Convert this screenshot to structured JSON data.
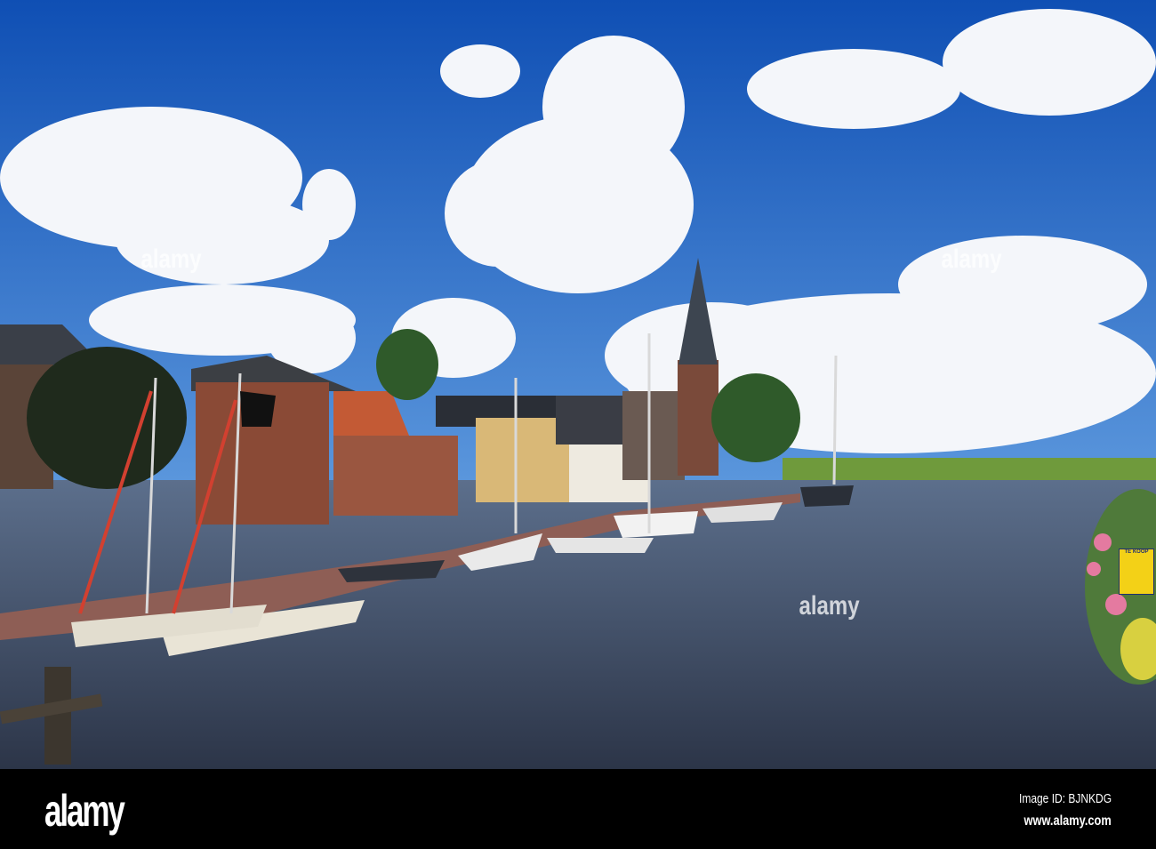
{
  "scene": {
    "description_tags": [
      "river",
      "village",
      "church-tower",
      "sailboats",
      "clouds"
    ],
    "colors": {
      "sky_top": "#0f4fb4",
      "sky_bottom": "#5a96dc",
      "water": "#3b4a62",
      "field": "#6f9a3c",
      "brick": "#8a4a36"
    }
  },
  "sign": {
    "label": "TE KOOP"
  },
  "watermark": {
    "text": "alamy"
  },
  "footer": {
    "logo": "alamy",
    "image_id": "Image ID: BJNKDG",
    "url": "www.alamy.com"
  }
}
